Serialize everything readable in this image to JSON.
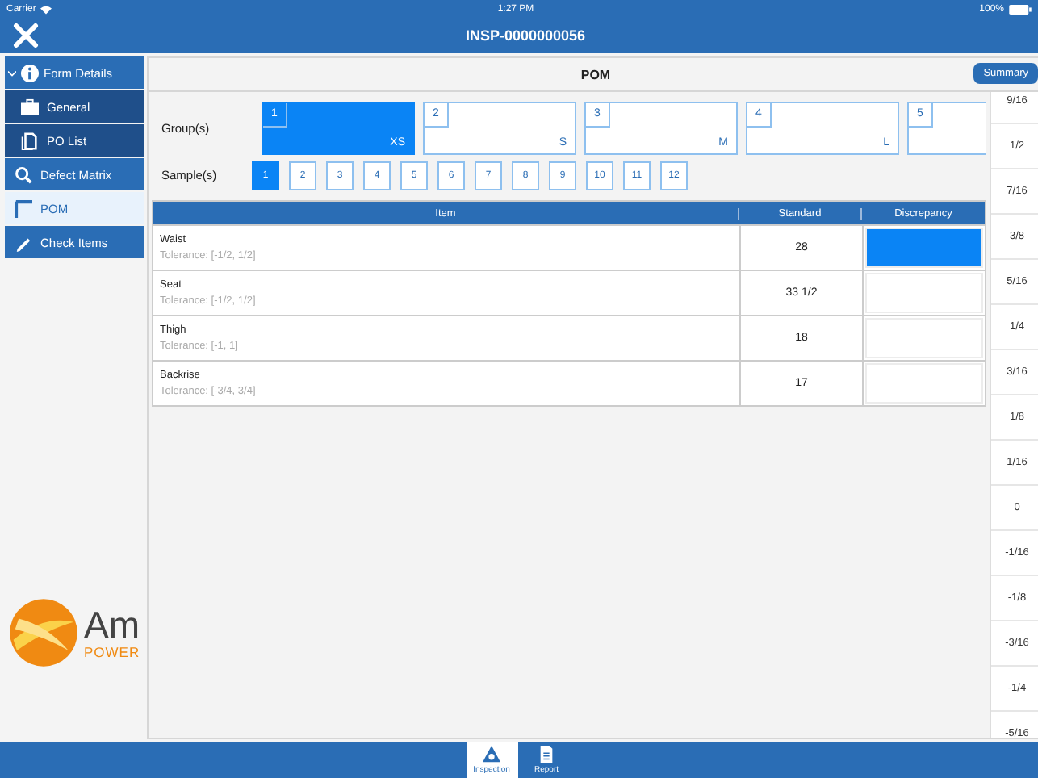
{
  "status_bar": {
    "carrier": "Carrier",
    "time": "1:27 PM",
    "battery": "100%"
  },
  "nav": {
    "title": "INSP-0000000056"
  },
  "sidebar": {
    "items": [
      {
        "label": "Form Details",
        "kind": "header",
        "expanded": true,
        "selected": false
      },
      {
        "label": "General",
        "kind": "sub",
        "selected": false
      },
      {
        "label": "PO List",
        "kind": "sub",
        "selected": false
      },
      {
        "label": "Defect Matrix",
        "kind": "item",
        "selected": false
      },
      {
        "label": "POM",
        "kind": "item",
        "selected": true
      },
      {
        "label": "Check Items",
        "kind": "item",
        "selected": false
      }
    ]
  },
  "logo": {
    "name": "Am",
    "tagline": "POWER"
  },
  "panel": {
    "title": "POM",
    "summary_button": "Summary"
  },
  "groups": {
    "label": "Group(s)",
    "items": [
      {
        "number": "1",
        "size": "XS",
        "selected": true
      },
      {
        "number": "2",
        "size": "S",
        "selected": false
      },
      {
        "number": "3",
        "size": "M",
        "selected": false
      },
      {
        "number": "4",
        "size": "L",
        "selected": false
      },
      {
        "number": "5",
        "selected": false
      }
    ]
  },
  "samples": {
    "label": "Sample(s)",
    "items": [
      {
        "label": "1",
        "selected": true
      },
      {
        "label": "2",
        "selected": false
      },
      {
        "label": "3",
        "selected": false
      },
      {
        "label": "4",
        "selected": false
      },
      {
        "label": "5",
        "selected": false
      },
      {
        "label": "6",
        "selected": false
      },
      {
        "label": "7",
        "selected": false
      },
      {
        "label": "8",
        "selected": false
      },
      {
        "label": "9",
        "selected": false
      },
      {
        "label": "10",
        "selected": false
      },
      {
        "label": "11",
        "selected": false
      },
      {
        "label": "12",
        "selected": false
      }
    ]
  },
  "table": {
    "columns": [
      "Item",
      "Standard",
      "Discrepancy"
    ],
    "rows": [
      {
        "item": "Waist",
        "tolerance": "Tolerance: [-1/2, 1/2]",
        "standard": "28",
        "selected": true
      },
      {
        "item": "Seat",
        "tolerance": "Tolerance: [-1/2, 1/2]",
        "standard": "33 1/2",
        "selected": false
      },
      {
        "item": "Thigh",
        "tolerance": "Tolerance: [-1, 1]",
        "standard": "18",
        "selected": false
      },
      {
        "item": "Backrise",
        "tolerance": "Tolerance: [-3/4, 3/4]",
        "standard": "17",
        "selected": false
      }
    ]
  },
  "ruler": [
    "9/16",
    "1/2",
    "7/16",
    "3/8",
    "5/16",
    "1/4",
    "3/16",
    "1/8",
    "1/16",
    "0",
    "-1/16",
    "-1/8",
    "-3/16",
    "-1/4",
    "-5/16"
  ],
  "tab_bar": {
    "tabs": [
      {
        "label": "Inspection",
        "selected": true
      },
      {
        "label": "Report",
        "selected": false
      }
    ]
  }
}
